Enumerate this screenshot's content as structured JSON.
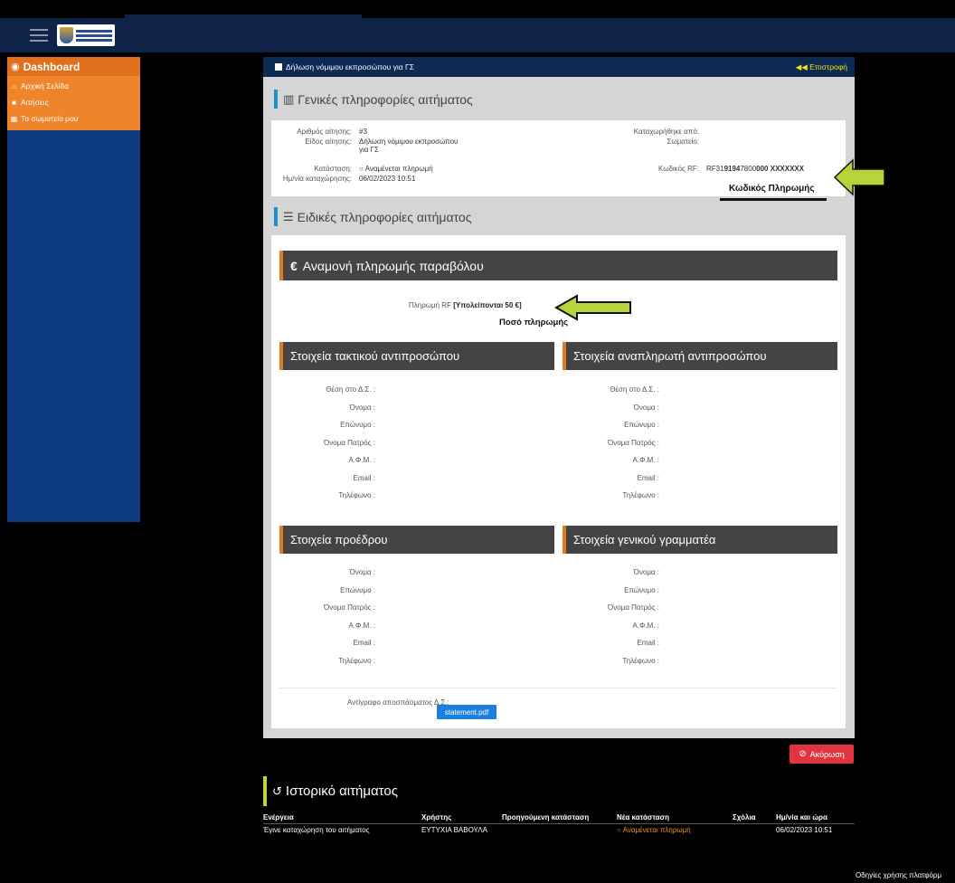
{
  "topbar": {
    "menu_icon": "hamburger-icon",
    "logo_icon": "organization-logo-icon"
  },
  "sidebar": {
    "header": "Dashboard",
    "header_icon": "dashboard-icon",
    "items": [
      {
        "label": "Αρχική Σελίδα",
        "icon": "home-icon"
      },
      {
        "label": "Αιτήσεις",
        "icon": "document-icon"
      },
      {
        "label": "Το σωματείο μου",
        "icon": "team-icon"
      }
    ]
  },
  "page": {
    "title": "Δήλωση νόμιμου εκπροσώπου για ΓΣ",
    "back_label": "Επιστροφή",
    "general_section": "Γενικές πληροφορίες αιτήματος",
    "special_section": "Ειδικές πληροφορίες αιτήματος"
  },
  "general": {
    "number_label": "Αριθμός αίτησης:",
    "number_value": "#3",
    "type_label": "Είδος αίτησης:",
    "type_value_line1": "Δήλωση νόμιμου εκπροσώπου",
    "type_value_line2": "για ΓΣ",
    "status_label": "Κατάσταση:",
    "status_value": "Αναμένεται πληρωμή",
    "date_label": "Ημ/νία καταχώρησης:",
    "date_value": "06/02/2023 10:51",
    "registered_by_label": "Καταχωρήθηκε από:",
    "club_label": "Σωματείο:",
    "rf_label": "Κωδικός RF:",
    "rf_prefix": "RF31",
    "rf_bold1": "9194",
    "rf_mid": "7800",
    "rf_bold2": "000 XXXXXXX"
  },
  "fee": {
    "header": "Αναμονή πληρωμής παραβόλου",
    "euro_icon": "euro-icon",
    "line_prefix": "Πληρωμή RF ",
    "line_bold": "[Υπολείπονται 50 €]"
  },
  "annotations": {
    "payment_code": "Κωδικός Πληρωμής",
    "payment_amount": "Ποσό πληρωμής",
    "arrow_color": "#b5d33a"
  },
  "regular_rep": {
    "title": "Στοιχεία τακτικού αντιπροσώπου",
    "fields": [
      "Θέση στο Δ.Σ. :",
      "Όνομα :",
      "Επώνυμο :",
      "Όνομα Πατρός :",
      "Α.Φ.Μ. :",
      "Email :",
      "Τηλέφωνο :"
    ]
  },
  "alternate_rep": {
    "title": "Στοιχεία αναπληρωτή αντιπροσώπου",
    "fields": [
      "Θέση στο Δ.Σ. :",
      "Όνομα :",
      "Επώνυμο :",
      "Όνομα Πατρός :",
      "Α.Φ.Μ. :",
      "Email :",
      "Τηλέφωνο :"
    ]
  },
  "president": {
    "title": "Στοιχεία προέδρου",
    "fields": [
      "Όνομα :",
      "Επώνυμο :",
      "Όνομα Πατρός :",
      "Α.Φ.Μ. :",
      "Email :",
      "Τηλέφωνο :"
    ]
  },
  "secretary": {
    "title": "Στοιχεία γενικού γραμματέα",
    "fields": [
      "Όνομα :",
      "Επώνυμο :",
      "Όνομα Πατρός :",
      "Α.Φ.Μ. :",
      "Email :",
      "Τηλέφωνο :"
    ]
  },
  "statement": {
    "label": "Αντίγραφο αποσπάσματος Δ.Σ.:",
    "file": "statement.pdf"
  },
  "cancel": {
    "label": "Ακύρωση",
    "icon": "ban-icon"
  },
  "history": {
    "title": "Ιστορικό αιτήματος",
    "icon": "history-icon",
    "columns": [
      "Ενέργεια",
      "Χρήστης",
      "Προηγούμενη κατάσταση",
      "Νέα κατάσταση",
      "Σχόλια",
      "Ημ/νία και ώρα"
    ],
    "rows": [
      {
        "action": "Έγινε καταχώρηση του αιτήματος",
        "user": "ΕΥΤΥΧΙΑ ΒΑΒΟΥΛΑ",
        "prev": "",
        "new": "Αναμένεται πληρωμή",
        "comments": "",
        "datetime": "06/02/2023 10:51"
      }
    ]
  },
  "footer": {
    "help_link": "Οδηγίες χρήσης πλατφόρμ"
  },
  "colors": {
    "navy": "#0f2349",
    "sidebar_blue": "#0f3b80",
    "orange": "#f0842a",
    "accent_blue": "#2090c8",
    "danger": "#e0353f"
  }
}
